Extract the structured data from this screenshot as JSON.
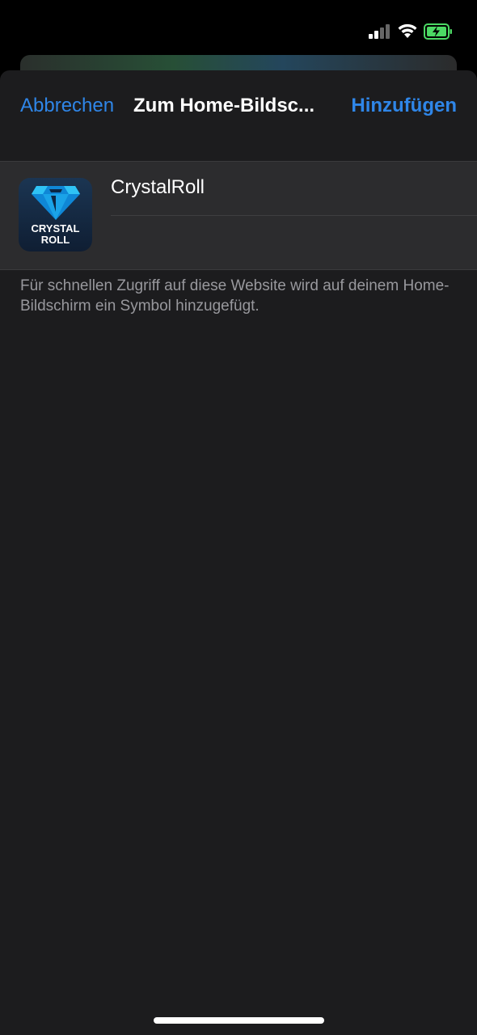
{
  "status_bar": {
    "signal_icon": "cellular-signal-icon",
    "wifi_icon": "wifi-icon",
    "battery_icon": "battery-charging-icon",
    "battery_color": "#4cd964"
  },
  "nav": {
    "cancel_label": "Abbrechen",
    "title": "Zum Home-Bildsc...",
    "add_label": "Hinzufügen",
    "accent_color": "#2f86e8"
  },
  "app": {
    "icon_name": "crystalroll-app-icon",
    "icon_line1": "CRYSTAL",
    "icon_line2": "ROLL",
    "name_value": "CrystalRoll"
  },
  "footer": {
    "note": "Für schnellen Zugriff auf diese Website wird auf deinem Home-Bildschirm ein Symbol hinzugefügt."
  }
}
